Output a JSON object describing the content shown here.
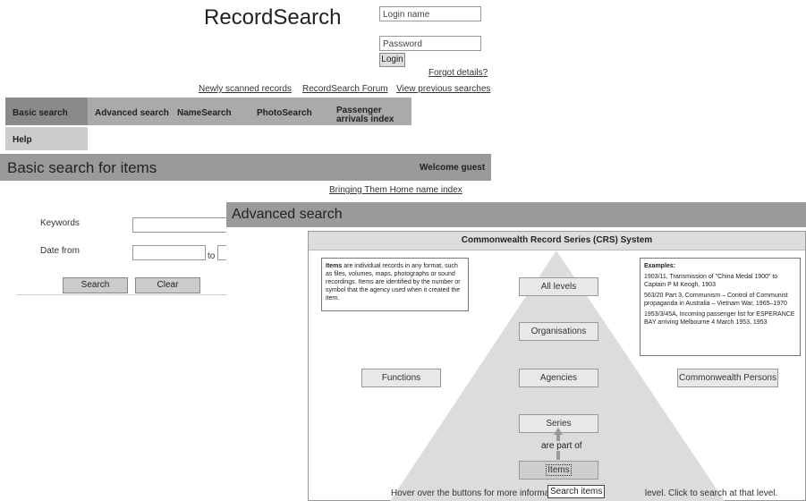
{
  "app_title": "RecordSearch",
  "login": {
    "name_placeholder": "Login name",
    "password_placeholder": "Password",
    "login_label": "Login",
    "forgot_label": "Forgot details?"
  },
  "top_links": [
    "Newly scanned records",
    "RecordSearch Forum",
    "View previous searches"
  ],
  "tabs": [
    "Basic search",
    "Advanced search",
    "NameSearch",
    "PhotoSearch",
    "Passenger arrivals index",
    "Help"
  ],
  "basic": {
    "heading": "Basic search for items",
    "welcome": "Welcome guest",
    "bth_link": "Bringing Them Home name index",
    "keywords_label": "Keywords",
    "date_from_label": "Date from",
    "to_label": "to",
    "search_label": "Search",
    "clear_label": "Clear"
  },
  "advanced": {
    "heading": "Advanced search",
    "crs_title": "Commonwealth Record Series (CRS) System",
    "items_desc_bold": "Items",
    "items_desc": " are individual records in any format, such as files, volumes, maps, photographs or sound recordings. Items are identified by the number or symbol that the agency used when it created the item.",
    "examples_title": "Examples:",
    "examples": [
      "1903/11, Transmission of \"China Medal 1900\" to Captain P M Keogh, 1903",
      "563/20 Part 3, Communism – Control of Communist propaganda in Australia – Vietnam War, 1965–1970",
      "1953/3/45A, Incoming passenger list for ESPERANCE BAY arriving Melbourne 4 March 1953, 1953"
    ],
    "nodes": {
      "all_levels": "All levels",
      "organisations": "Organisations",
      "functions": "Functions",
      "agencies": "Agencies",
      "persons": "Commonwealth Persons",
      "series": "Series",
      "items": "Items"
    },
    "are_part_of": "are part of",
    "hover_note": "Hover over the buttons for more informatio",
    "hover_note_tail": "level. Click to search at that level.",
    "tooltip": "Search items"
  }
}
